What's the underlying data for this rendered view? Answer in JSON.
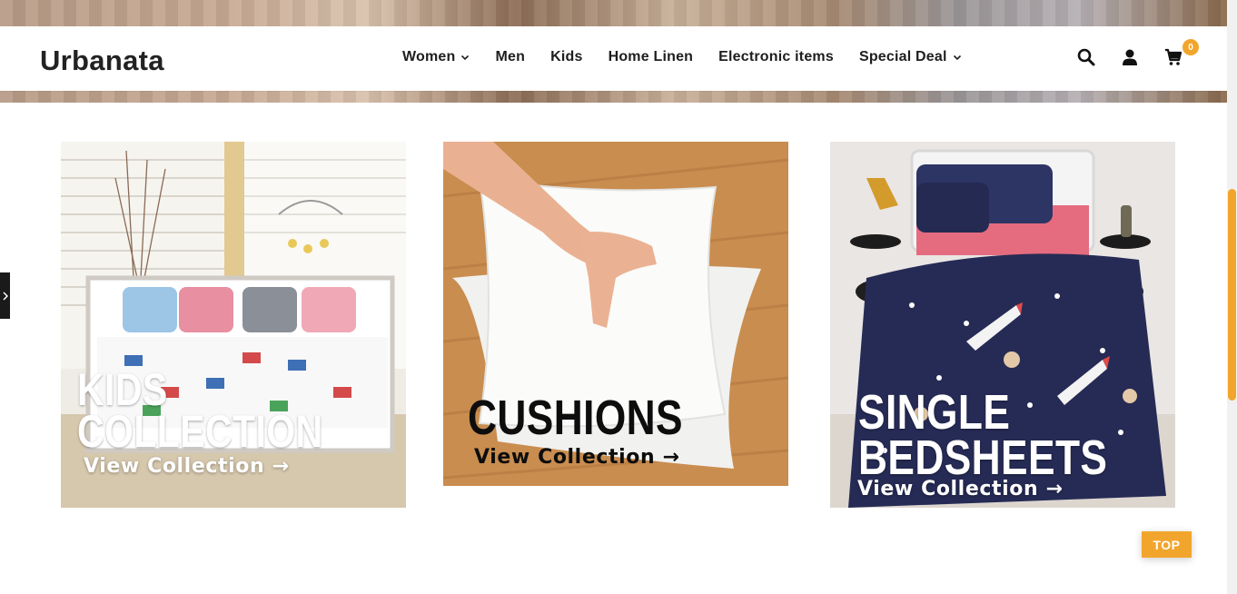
{
  "header": {
    "logo": "Urbanata",
    "nav": [
      {
        "label": "Women",
        "dropdown": true
      },
      {
        "label": "Men",
        "dropdown": false
      },
      {
        "label": "Kids",
        "dropdown": false
      },
      {
        "label": "Home Linen",
        "dropdown": false
      },
      {
        "label": "Electronic items",
        "dropdown": false
      },
      {
        "label": "Special Deal",
        "dropdown": true
      }
    ],
    "cart_count": "0",
    "icons": [
      "search-icon",
      "user-icon",
      "cart-icon"
    ]
  },
  "cards": [
    {
      "title_line1": "KIDS",
      "title_line2": "COLLECTION",
      "link": "View Collection →"
    },
    {
      "title_line1": "CUSHIONS",
      "title_line2": "",
      "link": "View Collection →"
    },
    {
      "title_line1": "SINGLE",
      "title_line2": "BEDSHEETS",
      "link": "View Collection →"
    }
  ],
  "top_button": "TOP",
  "colors": {
    "accent": "#f2a52c",
    "text": "#1e1e1e",
    "navy": "#252a52"
  }
}
